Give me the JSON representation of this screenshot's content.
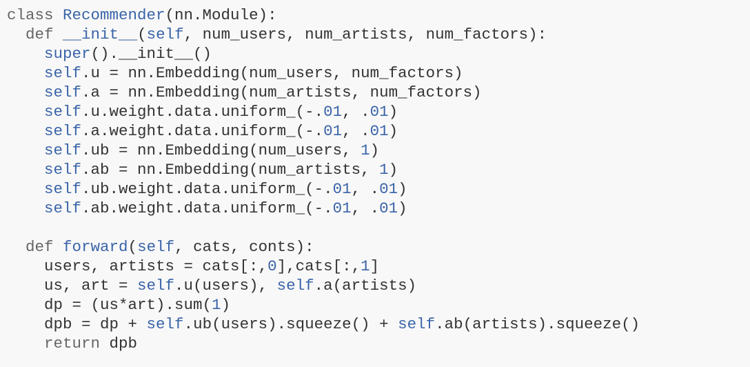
{
  "code": {
    "language": "python",
    "lines": [
      [
        {
          "t": "kw",
          "v": "class "
        },
        {
          "t": "fn",
          "v": "Recommender"
        },
        {
          "t": "plain",
          "v": "(nn.Module):"
        }
      ],
      [
        {
          "t": "plain",
          "v": "  "
        },
        {
          "t": "kw",
          "v": "def "
        },
        {
          "t": "fn",
          "v": "__init__"
        },
        {
          "t": "plain",
          "v": "("
        },
        {
          "t": "self",
          "v": "self"
        },
        {
          "t": "plain",
          "v": ", num_users, num_artists, num_factors):"
        }
      ],
      [
        {
          "t": "plain",
          "v": "    "
        },
        {
          "t": "self",
          "v": "super"
        },
        {
          "t": "plain",
          "v": "().__init__()"
        }
      ],
      [
        {
          "t": "plain",
          "v": "    "
        },
        {
          "t": "self",
          "v": "self"
        },
        {
          "t": "plain",
          "v": ".u = nn.Embedding(num_users, num_factors)"
        }
      ],
      [
        {
          "t": "plain",
          "v": "    "
        },
        {
          "t": "self",
          "v": "self"
        },
        {
          "t": "plain",
          "v": ".a = nn.Embedding(num_artists, num_factors)"
        }
      ],
      [
        {
          "t": "plain",
          "v": "    "
        },
        {
          "t": "self",
          "v": "self"
        },
        {
          "t": "plain",
          "v": ".u.weight.data.uniform_(-."
        },
        {
          "t": "num",
          "v": "01"
        },
        {
          "t": "plain",
          "v": ", ."
        },
        {
          "t": "num",
          "v": "01"
        },
        {
          "t": "plain",
          "v": ")"
        }
      ],
      [
        {
          "t": "plain",
          "v": "    "
        },
        {
          "t": "self",
          "v": "self"
        },
        {
          "t": "plain",
          "v": ".a.weight.data.uniform_(-."
        },
        {
          "t": "num",
          "v": "01"
        },
        {
          "t": "plain",
          "v": ", ."
        },
        {
          "t": "num",
          "v": "01"
        },
        {
          "t": "plain",
          "v": ")"
        }
      ],
      [
        {
          "t": "plain",
          "v": "    "
        },
        {
          "t": "self",
          "v": "self"
        },
        {
          "t": "plain",
          "v": ".ub = nn.Embedding(num_users, "
        },
        {
          "t": "num",
          "v": "1"
        },
        {
          "t": "plain",
          "v": ")"
        }
      ],
      [
        {
          "t": "plain",
          "v": "    "
        },
        {
          "t": "self",
          "v": "self"
        },
        {
          "t": "plain",
          "v": ".ab = nn.Embedding(num_artists, "
        },
        {
          "t": "num",
          "v": "1"
        },
        {
          "t": "plain",
          "v": ")"
        }
      ],
      [
        {
          "t": "plain",
          "v": "    "
        },
        {
          "t": "self",
          "v": "self"
        },
        {
          "t": "plain",
          "v": ".ub.weight.data.uniform_(-."
        },
        {
          "t": "num",
          "v": "01"
        },
        {
          "t": "plain",
          "v": ", ."
        },
        {
          "t": "num",
          "v": "01"
        },
        {
          "t": "plain",
          "v": ")"
        }
      ],
      [
        {
          "t": "plain",
          "v": "    "
        },
        {
          "t": "self",
          "v": "self"
        },
        {
          "t": "plain",
          "v": ".ab.weight.data.uniform_(-."
        },
        {
          "t": "num",
          "v": "01"
        },
        {
          "t": "plain",
          "v": ", ."
        },
        {
          "t": "num",
          "v": "01"
        },
        {
          "t": "plain",
          "v": ")"
        }
      ],
      [],
      [
        {
          "t": "plain",
          "v": "  "
        },
        {
          "t": "kw",
          "v": "def "
        },
        {
          "t": "fn",
          "v": "forward"
        },
        {
          "t": "plain",
          "v": "("
        },
        {
          "t": "self",
          "v": "self"
        },
        {
          "t": "plain",
          "v": ", cats, conts):"
        }
      ],
      [
        {
          "t": "plain",
          "v": "    users, artists = cats[:,"
        },
        {
          "t": "num",
          "v": "0"
        },
        {
          "t": "plain",
          "v": "],cats[:,"
        },
        {
          "t": "num",
          "v": "1"
        },
        {
          "t": "plain",
          "v": "]"
        }
      ],
      [
        {
          "t": "plain",
          "v": "    us, art = "
        },
        {
          "t": "self",
          "v": "self"
        },
        {
          "t": "plain",
          "v": ".u(users), "
        },
        {
          "t": "self",
          "v": "self"
        },
        {
          "t": "plain",
          "v": ".a(artists)"
        }
      ],
      [
        {
          "t": "plain",
          "v": "    dp = (us*art).sum("
        },
        {
          "t": "num",
          "v": "1"
        },
        {
          "t": "plain",
          "v": ")"
        }
      ],
      [
        {
          "t": "plain",
          "v": "    dpb = dp + "
        },
        {
          "t": "self",
          "v": "self"
        },
        {
          "t": "plain",
          "v": ".ub(users).squeeze() + "
        },
        {
          "t": "self",
          "v": "self"
        },
        {
          "t": "plain",
          "v": ".ab(artists).squeeze()"
        }
      ],
      [
        {
          "t": "plain",
          "v": "    "
        },
        {
          "t": "kw",
          "v": "return "
        },
        {
          "t": "plain",
          "v": "dpb"
        }
      ]
    ]
  },
  "colors": {
    "background": "#f8f8f8",
    "plain": "#333333",
    "keyword": "#666666",
    "name": "#3a64a8"
  }
}
